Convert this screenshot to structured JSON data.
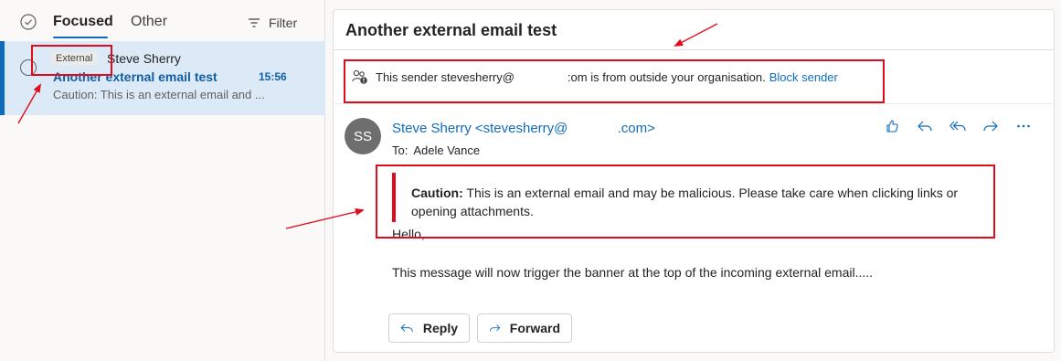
{
  "list": {
    "tabs": {
      "focused": "Focused",
      "other": "Other"
    },
    "filter_label": "Filter",
    "message": {
      "badge": "External",
      "sender": "Steve Sherry",
      "subject": "Another external email test",
      "time": "15:56",
      "preview": "Caution: This is an external email and ..."
    }
  },
  "reading": {
    "subject": "Another external email test",
    "external_notice": {
      "before": "This sender stevesherry@",
      "after": ":om is from outside your organisation.",
      "block_label": "Block sender"
    },
    "avatar_initials": "SS",
    "from": "Steve Sherry <stevesherry@             .com>",
    "to_label": "To:",
    "to_name": "Adele Vance",
    "caution_label": "Caution:",
    "caution_text": " This is an external email and may be malicious. Please take care when clicking links or opening attachments.",
    "body_greeting": "Hello,",
    "body_text": "This message will now trigger the banner at the top of the incoming external email.....",
    "reply_label": "Reply",
    "forward_label": "Forward"
  },
  "colors": {
    "accent": "#0f6cbd",
    "selected_row": "#dce9f7",
    "annotation_red": "#e00b1c"
  },
  "icons": [
    "check-circle-icon",
    "filter-icon",
    "person-warning-icon",
    "like-icon",
    "reply-icon",
    "reply-all-icon",
    "forward-icon",
    "more-icon"
  ]
}
